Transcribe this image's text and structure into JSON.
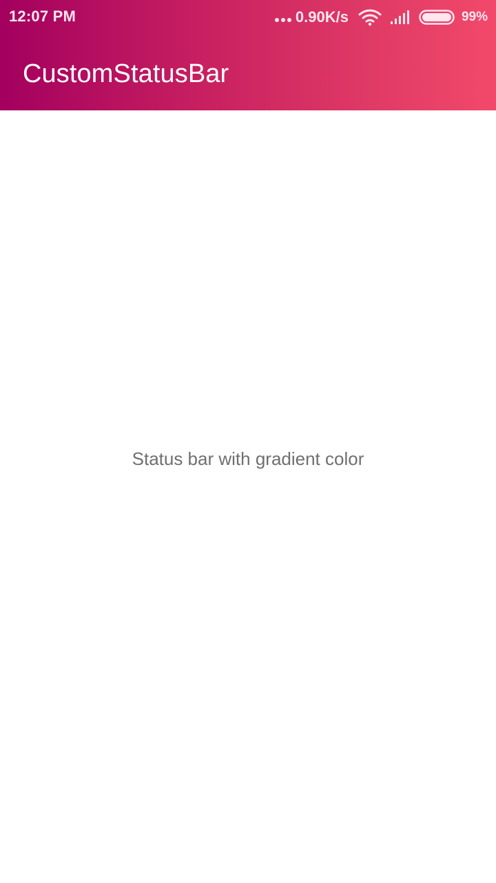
{
  "status_bar": {
    "time": "12:07 PM",
    "network_speed": "0.90K/s",
    "battery_percent": "99%",
    "battery_level": 0.99,
    "icons": [
      "more-dots-icon",
      "wifi-icon",
      "signal-icon",
      "battery-icon"
    ]
  },
  "app_bar": {
    "title": "CustomStatusBar"
  },
  "main": {
    "message": "Status bar with gradient color"
  },
  "colors": {
    "gradient_start": "#a3005f",
    "gradient_end": "#f2496a",
    "text_secondary": "#6f6f6f"
  }
}
